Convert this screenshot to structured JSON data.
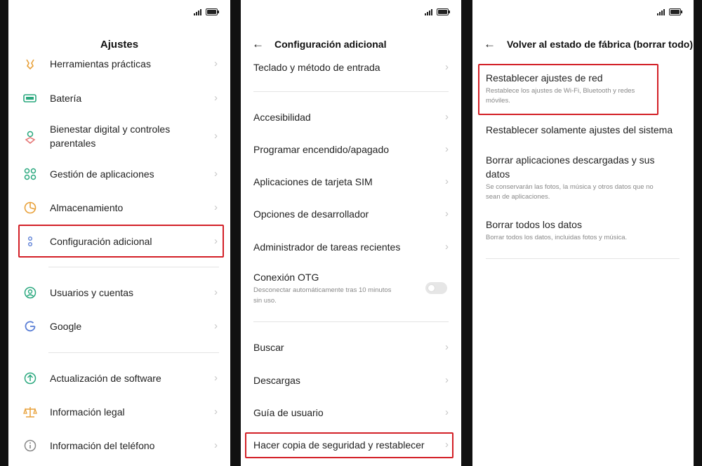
{
  "screen1": {
    "title": "Ajustes",
    "items": [
      {
        "label": "Herramientas prácticas",
        "icon": "tools-icon"
      },
      {
        "label": "Batería",
        "icon": "battery-icon"
      },
      {
        "label": "Bienestar digital y controles",
        "label2": "parentales",
        "icon": "wellbeing-icon"
      },
      {
        "label": "Gestión de aplicaciones",
        "icon": "apps-icon"
      },
      {
        "label": "Almacenamiento",
        "icon": "storage-icon"
      },
      {
        "label": "Configuración adicional",
        "icon": "additional-settings-icon"
      },
      {
        "label": "Usuarios y cuentas",
        "icon": "users-icon"
      },
      {
        "label": "Google",
        "icon": "google-icon"
      },
      {
        "label": "Actualización de software",
        "icon": "software-update-icon"
      },
      {
        "label": "Información legal",
        "icon": "legal-icon"
      },
      {
        "label": "Información del teléfono",
        "icon": "phone-info-icon"
      }
    ]
  },
  "screen2": {
    "title": "Configuración adicional",
    "items": [
      {
        "label": "Teclado y método de entrada"
      },
      {
        "label": "Accesibilidad"
      },
      {
        "label": "Programar encendido/apagado"
      },
      {
        "label": "Aplicaciones de tarjeta SIM"
      },
      {
        "label": "Opciones de desarrollador"
      },
      {
        "label": "Administrador de tareas recientes"
      },
      {
        "label": "Conexión OTG",
        "sub1": "Desconectar automáticamente tras 10 minutos",
        "sub2": "sin uso.",
        "toggle_on": false
      },
      {
        "label": "Buscar"
      },
      {
        "label": "Descargas"
      },
      {
        "label": "Guía de usuario"
      },
      {
        "label": "Hacer copia de seguridad y restablecer"
      }
    ]
  },
  "screen3": {
    "title": "Volver al estado de fábrica (borrar todo)",
    "items": [
      {
        "label": "Restablecer ajustes de red",
        "sub1": "Restablece los ajustes de Wi-Fi, Bluetooth y redes",
        "sub2": "móviles."
      },
      {
        "label": "Restablecer solamente ajustes del sistema"
      },
      {
        "label": "Borrar aplicaciones descargadas y sus",
        "label2": "datos",
        "sub1": "Se conservarán las fotos, la música y otros datos que no",
        "sub2": "sean de aplicaciones."
      },
      {
        "label": "Borrar todos los datos",
        "sub1": "Borrar todos los datos, incluidas fotos y música."
      }
    ]
  },
  "colors": {
    "highlight": "#d32027",
    "icon": "#2aa87e",
    "chevron": "#c6c6c6"
  }
}
